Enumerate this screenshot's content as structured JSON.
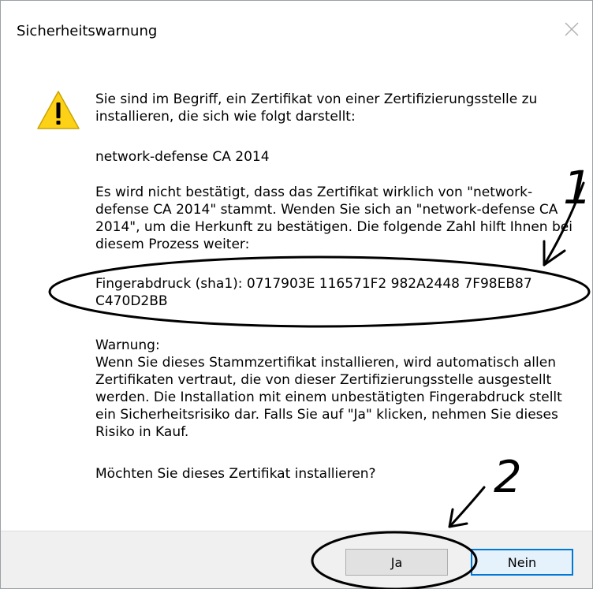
{
  "dialog": {
    "title": "Sicherheitswarnung",
    "close_icon": "close-icon",
    "warning_icon": "warning-triangle-icon"
  },
  "message": {
    "intro": "Sie sind im Begriff, ein Zertifikat von einer Zertifizierungsstelle zu installieren, die sich wie folgt darstellt:",
    "ca_name": "network-defense CA 2014",
    "verification_note": "Es wird nicht bestätigt, dass das Zertifikat wirklich von \"network-defense CA 2014\" stammt. Wenden Sie sich an \"network-defense CA 2014\", um die Herkunft zu bestätigen. Die folgende Zahl hilft Ihnen bei diesem Prozess weiter:",
    "fingerprint": "Fingerabdruck (sha1): 0717903E 116571F2 982A2448 7F98EB87 C470D2BB",
    "warning_heading": "Warnung:",
    "warning_text": "Wenn Sie dieses Stammzertifikat installieren, wird automatisch allen Zertifikaten vertraut, die von dieser Zertifizierungsstelle ausgestellt werden. Die Installation mit einem unbestätigten Fingerabdruck stellt ein Sicherheitsrisiko dar. Falls Sie auf \"Ja\" klicken, nehmen Sie dieses Risiko in Kauf.",
    "question": "Möchten Sie dieses Zertifikat installieren?"
  },
  "buttons": {
    "yes_label": "Ja",
    "no_label": "Nein"
  },
  "annotations": {
    "marker_1": "1",
    "marker_2": "2"
  },
  "colors": {
    "focus_border": "#0078d7",
    "warning_yellow": "#fcd116",
    "footer_bg": "#f0f0f0"
  }
}
